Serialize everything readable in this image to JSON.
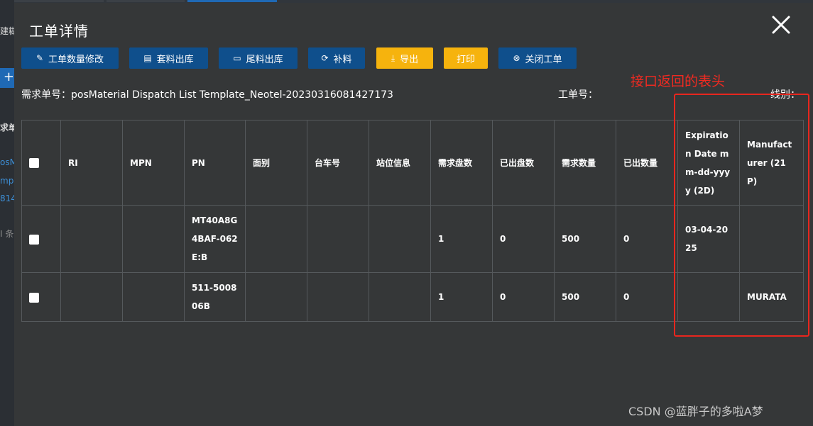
{
  "background": {
    "fragments": [
      "建糊",
      "求单",
      "osMa",
      "mpl",
      "814",
      "I 条"
    ]
  },
  "modal": {
    "title": "工单详情",
    "toolbar": {
      "buttons": [
        {
          "label": "工单数量修改",
          "icon": "edit-icon"
        },
        {
          "label": "套料出库",
          "icon": "document-icon"
        },
        {
          "label": "尾料出库",
          "icon": "folder-icon"
        },
        {
          "label": "补料",
          "icon": "refill-icon"
        },
        {
          "label": "导出",
          "icon": "download-icon"
        },
        {
          "label": "打印",
          "icon": ""
        },
        {
          "label": "关闭工单",
          "icon": "close-circle-icon"
        }
      ]
    },
    "info": {
      "demand_label": "需求单号：",
      "demand_value": "posMaterial Dispatch List Template_Neotel-20230316081427173",
      "workorder_label": "工单号：",
      "line_label": "线别："
    },
    "annotation": "接口返回的表头",
    "table": {
      "headers": [
        "RI",
        "MPN",
        "PN",
        "面别",
        "台车号",
        "站位信息",
        "需求盘数",
        "已出盘数",
        "需求数量",
        "已出数量",
        "Expiration Date mm-dd-yyyy (2D)",
        "Manufacturer (21P)"
      ],
      "rows": [
        [
          "",
          "",
          "MT40A8G4BAF-062E:B",
          "",
          "",
          "",
          "1",
          "0",
          "500",
          "0",
          "03-04-2025",
          ""
        ],
        [
          "",
          "",
          "511-500806B",
          "",
          "",
          "",
          "1",
          "0",
          "500",
          "0",
          "",
          "MURATA"
        ]
      ]
    }
  },
  "watermark": "CSDN @蓝胖子的多啦A梦",
  "colors": {
    "primary_button": "#0f4f8c",
    "accent_button": "#f6b30d",
    "annotation": "#e8261e",
    "modal_bg": "#353738"
  }
}
